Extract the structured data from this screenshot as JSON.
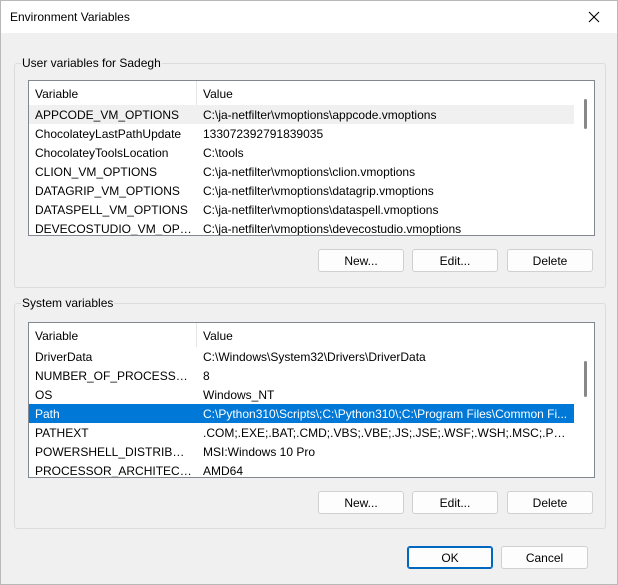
{
  "window": {
    "title": "Environment Variables"
  },
  "user_vars": {
    "group_label": "User variables for Sadegh",
    "columns": [
      "Variable",
      "Value"
    ],
    "rows": [
      {
        "name": "APPCODE_VM_OPTIONS",
        "value": "C:\\ja-netfilter\\vmoptions\\appcode.vmoptions"
      },
      {
        "name": "ChocolateyLastPathUpdate",
        "value": "133072392791839035"
      },
      {
        "name": "ChocolateyToolsLocation",
        "value": "C:\\tools"
      },
      {
        "name": "CLION_VM_OPTIONS",
        "value": "C:\\ja-netfilter\\vmoptions\\clion.vmoptions"
      },
      {
        "name": "DATAGRIP_VM_OPTIONS",
        "value": "C:\\ja-netfilter\\vmoptions\\datagrip.vmoptions"
      },
      {
        "name": "DATASPELL_VM_OPTIONS",
        "value": "C:\\ja-netfilter\\vmoptions\\dataspell.vmoptions"
      },
      {
        "name": "DEVECOSTUDIO_VM_OPTIO...",
        "value": "C:\\ja-netfilter\\vmoptions\\devecostudio.vmoptions"
      }
    ],
    "buttons": {
      "new": "New...",
      "edit": "Edit...",
      "delete": "Delete"
    }
  },
  "system_vars": {
    "group_label": "System variables",
    "columns": [
      "Variable",
      "Value"
    ],
    "rows": [
      {
        "name": "DriverData",
        "value": "C:\\Windows\\System32\\Drivers\\DriverData"
      },
      {
        "name": "NUMBER_OF_PROCESSORS",
        "value": "8"
      },
      {
        "name": "OS",
        "value": "Windows_NT"
      },
      {
        "name": "Path",
        "value": "C:\\Python310\\Scripts\\;C:\\Python310\\;C:\\Program Files\\Common Fi..."
      },
      {
        "name": "PATHEXT",
        "value": ".COM;.EXE;.BAT;.CMD;.VBS;.VBE;.JS;.JSE;.WSF;.WSH;.MSC;.PY;.PYW"
      },
      {
        "name": "POWERSHELL_DISTRIBUTIO...",
        "value": "MSI:Windows 10 Pro"
      },
      {
        "name": "PROCESSOR_ARCHITECTURE",
        "value": "AMD64"
      }
    ],
    "selected_row": "Path",
    "buttons": {
      "new": "New...",
      "edit": "Edit...",
      "delete": "Delete"
    }
  },
  "footer": {
    "ok": "OK",
    "cancel": "Cancel"
  },
  "icons": {
    "close": "close-icon"
  }
}
